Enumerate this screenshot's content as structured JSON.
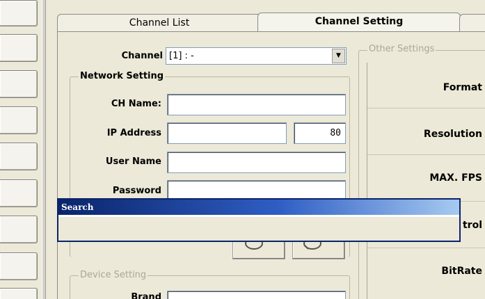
{
  "tabs": {
    "channel_list": "Channel List",
    "channel_setting": "Channel Setting"
  },
  "channel": {
    "label": "Channel",
    "selected": "[1] : -"
  },
  "network": {
    "title": "Network Setting",
    "ch_name_label": "CH Name:",
    "ch_name_value": "",
    "ip_label": "IP Address",
    "ip_value": "",
    "port_value": "80",
    "user_label": "User Name",
    "user_value": "",
    "password_label": "Password",
    "password_value": ""
  },
  "device": {
    "title": "Device Setting",
    "brand_label": "Brand"
  },
  "other_settings": {
    "title": "Other Settings",
    "items": [
      "Format",
      "Resolution",
      "MAX. FPS",
      "trol",
      "BitRate"
    ]
  },
  "search_dialog": {
    "title": "Search"
  },
  "colors": {
    "window_bg": "#ece9d8",
    "dialog_title": "#0a246a",
    "input_border": "#7f9db9"
  }
}
